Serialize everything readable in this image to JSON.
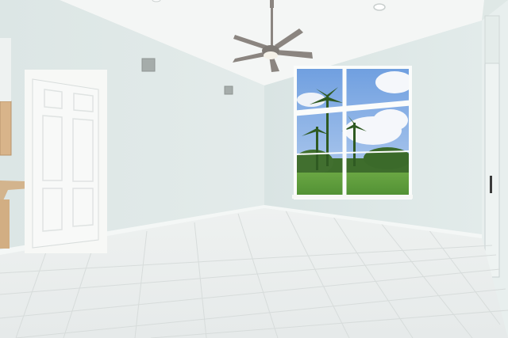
{
  "palette": {
    "ceiling": "#f4f6f5",
    "wall_left": "#dfe8e6",
    "wall_back": "#d7e3e2",
    "wall_right": "#e8efee",
    "floor": "#e9edec",
    "floor_grout": "#d7dcdb",
    "door": "#f7f8f7",
    "trim": "#f7f8f6",
    "cabinet": "#d8b48a",
    "window_frame": "#fbfcfb",
    "sky": "#8fb4e6",
    "cloud": "#f5f7fb",
    "grass": "#5b9a3a",
    "foliage": "#3e6d2c",
    "fan_blade": "#8b8580",
    "fan_light": "#f4f1e8"
  }
}
